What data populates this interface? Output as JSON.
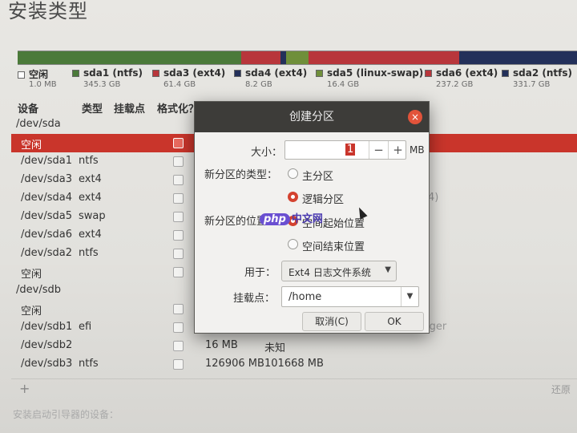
{
  "title": "安装类型",
  "partition_bar": [
    {
      "color": "#4b7a3a",
      "share": 0.4
    },
    {
      "color": "#b8363b",
      "share": 0.07
    },
    {
      "color": "#23305a",
      "share": 0.01
    },
    {
      "color": "#6f8f3a",
      "share": 0.04
    },
    {
      "color": "#b8363b",
      "share": 0.27
    },
    {
      "color": "#23305a",
      "share": 0.21
    }
  ],
  "legend": [
    {
      "name": "空闲",
      "size": "1.0 MB",
      "color": "#ffffff"
    },
    {
      "name": "sda1 (ntfs)",
      "size": "345.3 GB",
      "color": "#4b7a3a"
    },
    {
      "name": "sda3 (ext4)",
      "size": "61.4 GB",
      "color": "#b8363b"
    },
    {
      "name": "sda4 (ext4)",
      "size": "8.2 GB",
      "color": "#23305a"
    },
    {
      "name": "sda5 (linux-swap)",
      "size": "16.4 GB",
      "color": "#6f8f3a"
    },
    {
      "name": "sda6 (ext4)",
      "size": "237.2 GB",
      "color": "#b8363b"
    },
    {
      "name": "sda2 (ntfs)",
      "size": "331.7 GB",
      "color": "#23305a"
    }
  ],
  "table": {
    "headers": {
      "device": "设备",
      "type": "类型",
      "mount": "挂载点",
      "format": "格式化？"
    },
    "rows": [
      {
        "device": "/dev/sda",
        "type": "",
        "cb": false,
        "extra": ""
      },
      {
        "device": "空闲",
        "type": "",
        "cb": true,
        "extra": "",
        "selected": true
      },
      {
        "device": "/dev/sda1",
        "type": "ntfs",
        "cb": true,
        "extra": ""
      },
      {
        "device": "/dev/sda3",
        "type": "ext4",
        "cb": true,
        "extra": ""
      },
      {
        "device": "/dev/sda4",
        "type": "ext4",
        "cb": true,
        "extra": "4)"
      },
      {
        "device": "/dev/sda5",
        "type": "swap",
        "cb": true,
        "extra": ""
      },
      {
        "device": "/dev/sda6",
        "type": "ext4",
        "cb": true,
        "extra": ""
      },
      {
        "device": "/dev/sda2",
        "type": "ntfs",
        "cb": true,
        "extra": ""
      },
      {
        "device": "空闲",
        "type": "",
        "cb": true,
        "extra": ""
      },
      {
        "device": "/dev/sdb",
        "type": "",
        "cb": false,
        "extra": ""
      },
      {
        "device": "空闲",
        "type": "",
        "cb": true,
        "extra": ""
      },
      {
        "device": "/dev/sdb1",
        "type": "efi",
        "cb": true,
        "extra": "Windows Boot Manager"
      },
      {
        "device": "/dev/sdb2",
        "type": "",
        "cb": true,
        "size": "16 MB",
        "used": "未知"
      },
      {
        "device": "/dev/sdb3",
        "type": "ntfs",
        "cb": true,
        "size": "126906 MB",
        "used": "101668 MB"
      }
    ]
  },
  "bottom": {
    "add": "+",
    "right": "还原"
  },
  "bootloader_label": "安装启动引导器的设备：",
  "dialog": {
    "title": "创建分区",
    "close": "×",
    "size_label": "大小：",
    "size_value": "1",
    "minus": "−",
    "plus": "+",
    "unit": "MB",
    "type_label": "新分区的类型：",
    "type_primary": "主分区",
    "type_logical": "逻辑分区",
    "location_label": "新分区的位置：",
    "location_start": "空间起始位置",
    "location_end": "空间结束位置",
    "use_label": "用于：",
    "use_value": "Ext4 日志文件系统",
    "mount_label": "挂载点：",
    "mount_value": "/home",
    "cancel": "取消(C)",
    "ok": "OK"
  },
  "watermark": {
    "p": "php",
    "c": "中文网"
  }
}
